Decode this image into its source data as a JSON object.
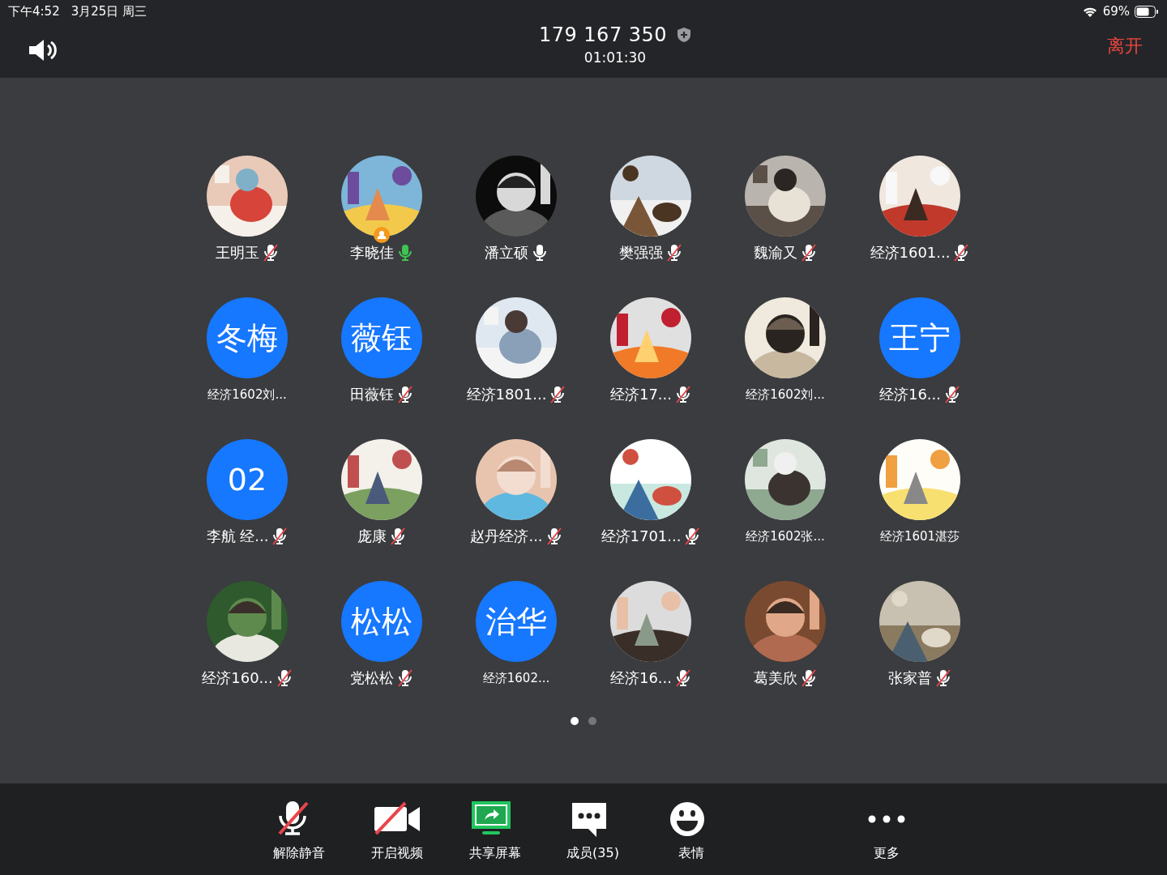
{
  "status_bar": {
    "time": "下午4:52",
    "date": "3月25日 周三",
    "battery": "69%"
  },
  "header": {
    "meeting_id": "179 167 350",
    "duration": "01:01:30",
    "leave": "离开"
  },
  "participants": [
    {
      "name": "王明玉",
      "mic_icon": true,
      "muted": true,
      "speaking": false,
      "host": false
    },
    {
      "name": "李晓佳",
      "mic_icon": true,
      "muted": false,
      "speaking": true,
      "host": true
    },
    {
      "name": "潘立硕",
      "mic_icon": true,
      "muted": false,
      "speaking": false,
      "host": false
    },
    {
      "name": "樊强强",
      "mic_icon": true,
      "muted": true,
      "speaking": false,
      "host": false
    },
    {
      "name": "魏渝又",
      "mic_icon": true,
      "muted": true,
      "speaking": false,
      "host": false
    },
    {
      "name": "经济1601...",
      "mic_icon": true,
      "muted": true,
      "speaking": false,
      "host": false
    },
    {
      "name": "经济1602刘...",
      "avatar": {
        "kind": "initials",
        "text": "冬梅"
      },
      "mic_icon": false,
      "host": false
    },
    {
      "name": "田薇钰",
      "avatar": {
        "kind": "initials",
        "text": "薇钰"
      },
      "mic_icon": true,
      "muted": true,
      "speaking": false,
      "host": false
    },
    {
      "name": "经济1801...",
      "mic_icon": true,
      "muted": true,
      "speaking": false,
      "host": false
    },
    {
      "name": "经济17...",
      "mic_icon": true,
      "muted": true,
      "speaking": false,
      "host": false
    },
    {
      "name": "经济1602刘...",
      "mic_icon": false,
      "host": false
    },
    {
      "name": "经济16...",
      "avatar": {
        "kind": "initials",
        "text": "王宁"
      },
      "mic_icon": true,
      "muted": true,
      "speaking": false,
      "host": false
    },
    {
      "name": "李航 经...",
      "avatar": {
        "kind": "initials",
        "text": "02"
      },
      "mic_icon": true,
      "muted": true,
      "speaking": false,
      "host": false
    },
    {
      "name": "庞康",
      "mic_icon": true,
      "muted": true,
      "speaking": false,
      "host": false
    },
    {
      "name": "赵丹经济...",
      "mic_icon": true,
      "muted": true,
      "speaking": false,
      "host": false
    },
    {
      "name": "经济1701...",
      "mic_icon": true,
      "muted": true,
      "speaking": false,
      "host": false
    },
    {
      "name": "经济1602张...",
      "mic_icon": false,
      "host": false
    },
    {
      "name": "经济1601湛莎",
      "mic_icon": false,
      "host": false
    },
    {
      "name": "经济160...",
      "mic_icon": true,
      "muted": true,
      "speaking": false,
      "host": false
    },
    {
      "name": "党松松",
      "avatar": {
        "kind": "initials",
        "text": "松松"
      },
      "mic_icon": true,
      "muted": true,
      "speaking": false,
      "host": false
    },
    {
      "name": "经济1602...",
      "avatar": {
        "kind": "initials",
        "text": "治华"
      },
      "mic_icon": false,
      "host": false
    },
    {
      "name": "经济16...",
      "mic_icon": true,
      "muted": true,
      "speaking": false,
      "host": false
    },
    {
      "name": "葛美欣",
      "mic_icon": true,
      "muted": true,
      "speaking": false,
      "host": false
    },
    {
      "name": "张家普",
      "mic_icon": true,
      "muted": true,
      "speaking": false,
      "host": false
    }
  ],
  "pages": [
    {
      "selected": true
    },
    {
      "selected": false
    }
  ],
  "toolbar": [
    {
      "kind": "mic-off",
      "label": "解除静音"
    },
    {
      "kind": "video-off",
      "label": "开启视频"
    },
    {
      "kind": "share",
      "label": "共享屏幕"
    },
    {
      "kind": "members",
      "label": "成员(35)"
    },
    {
      "kind": "emoji",
      "label": "表情"
    },
    {
      "kind": "more",
      "label": "更多"
    }
  ]
}
